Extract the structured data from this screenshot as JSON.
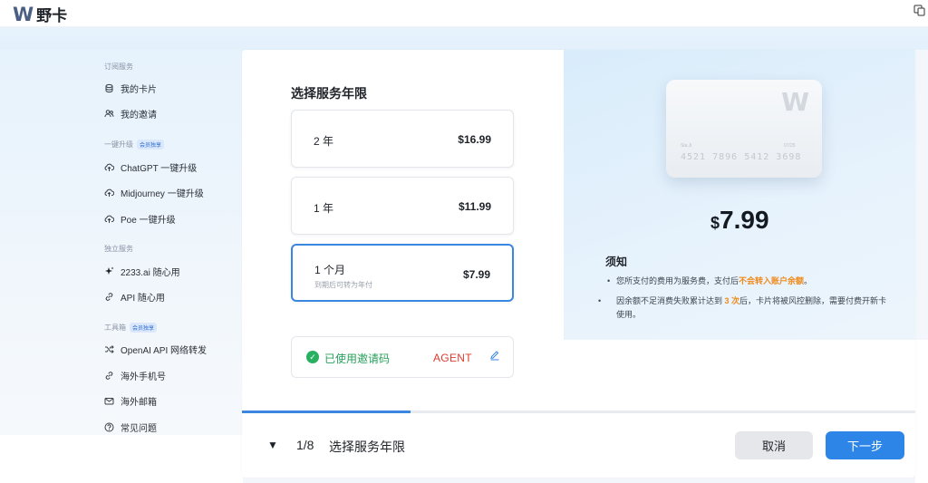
{
  "app": {
    "logo_mark": "W",
    "name": "野卡"
  },
  "sidebar": {
    "sections": [
      {
        "title": "订阅服务",
        "badge": ""
      },
      {
        "title": "一键升级",
        "badge": "会员独享"
      },
      {
        "title": "独立服务",
        "badge": ""
      },
      {
        "title": "工具箱",
        "badge": "会员独享"
      }
    ],
    "items": [
      {
        "label": "我的卡片",
        "icon": "coins-icon"
      },
      {
        "label": "我的邀请",
        "icon": "users-icon"
      },
      {
        "label": "ChatGPT 一键升级",
        "icon": "cloud-upload-icon"
      },
      {
        "label": "Midjourney 一键升级",
        "icon": "cloud-upload-icon"
      },
      {
        "label": "Poe 一键升级",
        "icon": "cloud-upload-icon"
      },
      {
        "label": "2233.ai 随心用",
        "icon": "sparkle-icon"
      },
      {
        "label": "API 随心用",
        "icon": "link-icon"
      },
      {
        "label": "OpenAI API 网络转发",
        "icon": "shuffle-icon"
      },
      {
        "label": "海外手机号",
        "icon": "link-icon"
      },
      {
        "label": "海外邮箱",
        "icon": "mail-icon"
      },
      {
        "label": "常见问题",
        "icon": "help-icon"
      }
    ]
  },
  "plans": {
    "title": "选择服务年限",
    "options": [
      {
        "name": "2 年",
        "sub": "",
        "price": "$16.99",
        "selected": false
      },
      {
        "name": "1 年",
        "sub": "",
        "price": "$11.99",
        "selected": false
      },
      {
        "name": "1 个月",
        "sub": "到期后可转为年付",
        "price": "$7.99",
        "selected": true
      }
    ]
  },
  "invite": {
    "label": "已使用邀请码",
    "code": "AGENT"
  },
  "preview": {
    "card": {
      "mark": "W",
      "holder": "Sla.Ji",
      "expiry": "07/25",
      "number": "4521  7896  5412  3698"
    },
    "price_currency": "$",
    "price_amount": "7.99",
    "notice_title": "须知",
    "notice_1_pre": "您所支付的费用为服务费，支付后",
    "notice_1_highlight": "不会转入账户余额",
    "notice_1_post": "。",
    "notice_2_pre": "因余额不足消费失败累计达到 ",
    "notice_2_highlight": "3 次",
    "notice_2_post": "后，卡片将被风控删除，需要付费开新卡使用。"
  },
  "footer": {
    "step_count": "1/8",
    "step_title": "选择服务年限",
    "progress": 0.25,
    "cancel_label": "取消",
    "next_label": "下一步"
  },
  "colors": {
    "accent": "#2e85e8",
    "success": "#27b05f",
    "highlight": "#f08a1c",
    "invite_code": "#e23a2e"
  }
}
